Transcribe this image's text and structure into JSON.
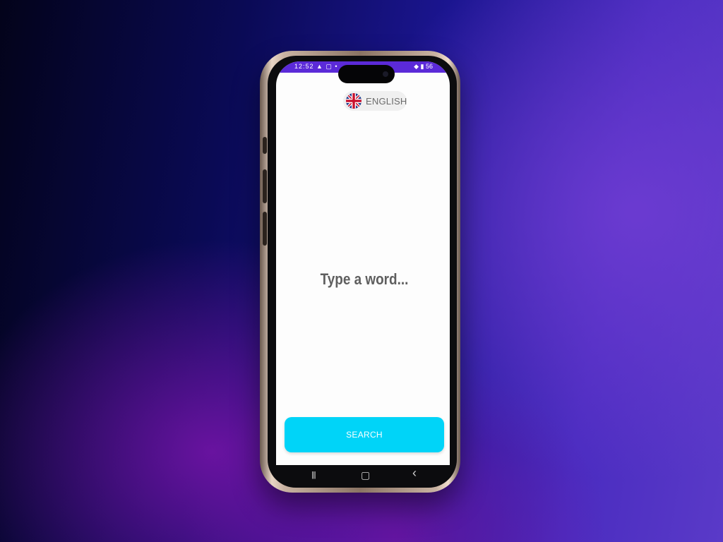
{
  "status_bar": {
    "left_text": "12:52 ▲ ▢ •",
    "right_text": "◆ ▮ 56"
  },
  "language": {
    "label": "ENGLISH",
    "flag": "uk-flag-icon"
  },
  "search": {
    "placeholder": "Type a word...",
    "value": "",
    "button_label": "SEARCH"
  },
  "nav_bar": {
    "recents": "|||",
    "home": "▢",
    "back": "‹"
  },
  "colors": {
    "accent": "#00d4f8",
    "status_bar": "#5b2ad8",
    "screen_bg": "#fdfdfd"
  }
}
